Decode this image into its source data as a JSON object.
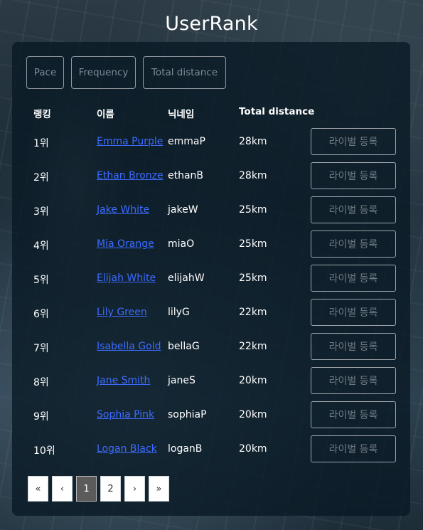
{
  "title": "UserRank",
  "filters": [
    "Pace",
    "Frequency",
    "Total distance"
  ],
  "headers": {
    "rank": "랭킹",
    "name": "이름",
    "nickname": "닉네임",
    "distance": "Total distance"
  },
  "rows": [
    {
      "rank": "1위",
      "name": "Emma Purple",
      "nickname": "emmaP",
      "distance": "28km",
      "action": "라이벌 등록"
    },
    {
      "rank": "2위",
      "name": "Ethan Bronze",
      "nickname": "ethanB",
      "distance": "28km",
      "action": "라이벌 등록"
    },
    {
      "rank": "3위",
      "name": "Jake White",
      "nickname": "jakeW",
      "distance": "25km",
      "action": "라이벌 등록"
    },
    {
      "rank": "4위",
      "name": "Mia Orange",
      "nickname": "miaO",
      "distance": "25km",
      "action": "라이벌 등록"
    },
    {
      "rank": "5위",
      "name": "Elijah White",
      "nickname": "elijahW",
      "distance": "25km",
      "action": "라이벌 등록"
    },
    {
      "rank": "6위",
      "name": "Lily Green",
      "nickname": "lilyG",
      "distance": "22km",
      "action": "라이벌 등록"
    },
    {
      "rank": "7위",
      "name": "Isabella Gold",
      "nickname": "bellaG",
      "distance": "22km",
      "action": "라이벌 등록"
    },
    {
      "rank": "8위",
      "name": "Jane Smith",
      "nickname": "janeS",
      "distance": "20km",
      "action": "라이벌 등록"
    },
    {
      "rank": "9위",
      "name": "Sophia Pink",
      "nickname": "sophiaP",
      "distance": "20km",
      "action": "라이벌 등록"
    },
    {
      "rank": "10위",
      "name": "Logan Black",
      "nickname": "loganB",
      "distance": "20km",
      "action": "라이벌 등록"
    }
  ],
  "pagination": {
    "first": "«",
    "prev": "‹",
    "pages": [
      "1",
      "2"
    ],
    "current": "1",
    "next": "›",
    "last": "»"
  },
  "colors": {
    "link": "#3d6bff",
    "panel": "#081824",
    "active_page": "#5b5b5b"
  }
}
